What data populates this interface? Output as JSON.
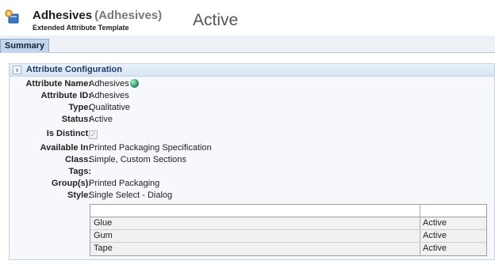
{
  "header": {
    "icon": "attribute-template-icon",
    "title": "Adhesives",
    "title_paren": "(Adhesives)",
    "subtitle": "Extended Attribute Template",
    "status": "Active"
  },
  "tabs": [
    {
      "label": "Summary",
      "selected": true
    }
  ],
  "section": {
    "title": "Attribute Configuration",
    "collapse_icon": "chevron-down-icon"
  },
  "fields": {
    "attribute_name": {
      "label": "Attribute Name:",
      "value": "Adhesives"
    },
    "attribute_id": {
      "label": "Attribute ID:",
      "value": "Adhesives"
    },
    "type": {
      "label": "Type:",
      "value": "Qualitative"
    },
    "status": {
      "label": "Status:",
      "value": "Active"
    },
    "is_distinct": {
      "label": "Is Distinct:",
      "checked": true
    },
    "available_in": {
      "label": "Available In:",
      "value": "Printed Packaging Specification"
    },
    "class": {
      "label": "Class:",
      "value": "Simple, Custom Sections"
    },
    "tags": {
      "label": "Tags:",
      "value": ""
    },
    "groups": {
      "label": "Group(s):",
      "value": "Printed Packaging"
    },
    "style": {
      "label": "Style:",
      "value": "Single Select - Dialog"
    }
  },
  "style_table": {
    "columns": [
      "",
      ""
    ],
    "rows": [
      {
        "name": "Glue",
        "status": "Active"
      },
      {
        "name": "Gum",
        "status": "Active"
      },
      {
        "name": "Tape",
        "status": "Active"
      }
    ]
  },
  "colors": {
    "tab_bg": "#c3d5ea",
    "panel_header": "#d7e4f3",
    "panel_title": "#1e3f6b"
  }
}
